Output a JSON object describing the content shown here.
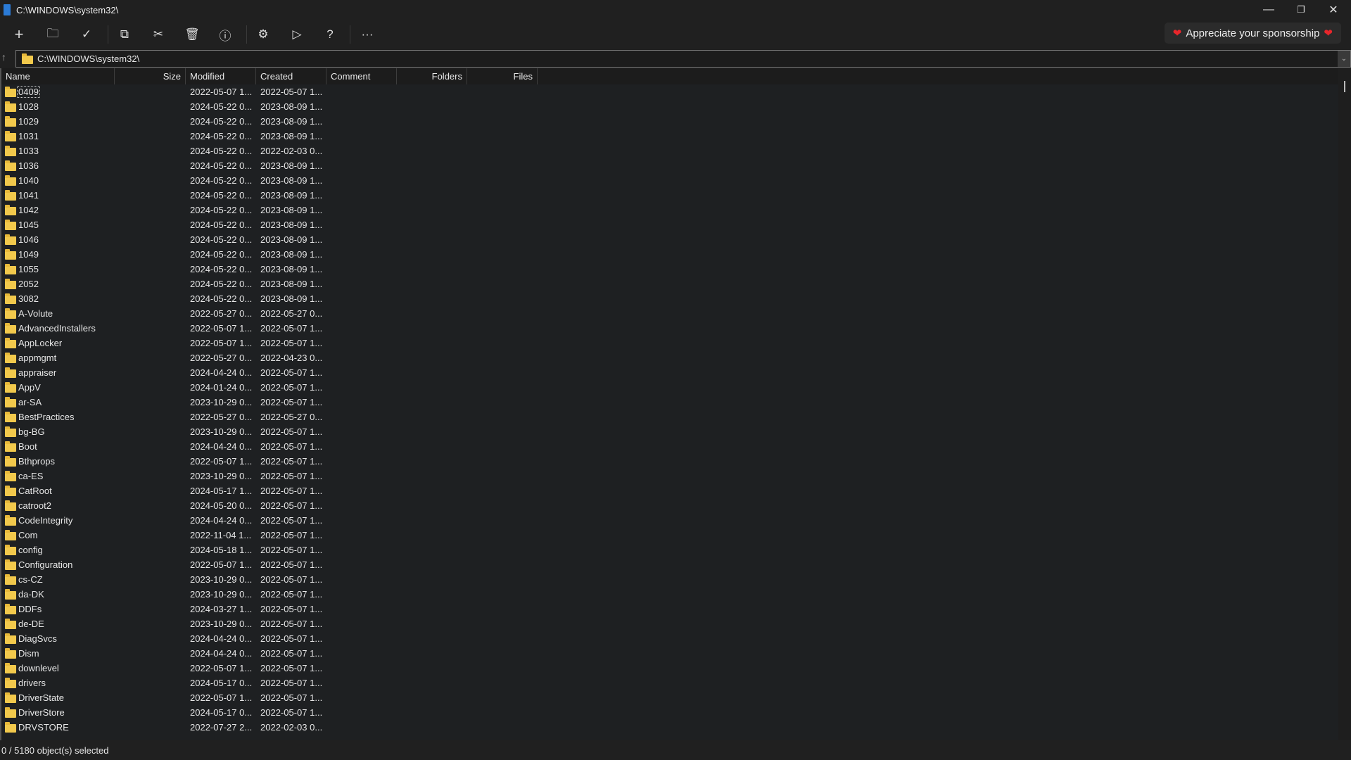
{
  "window": {
    "title": "C:\\WINDOWS\\system32\\"
  },
  "toolbar": {
    "buttons": [
      "add-icon",
      "extract-folder-icon",
      "test-icon",
      "copy-icon",
      "move-icon",
      "delete-icon",
      "info-icon",
      "settings-icon",
      "run-icon",
      "help-icon",
      "more-icon"
    ],
    "sponsor": "Appreciate your sponsorship"
  },
  "address": {
    "path": "C:\\WINDOWS\\system32\\"
  },
  "columns": [
    "Name",
    "Size",
    "Modified",
    "Created",
    "Comment",
    "Folders",
    "Files"
  ],
  "rows": [
    [
      "0409",
      "2022-05-07 1...",
      "2022-05-07 1..."
    ],
    [
      "1028",
      "2024-05-22 0...",
      "2023-08-09 1..."
    ],
    [
      "1029",
      "2024-05-22 0...",
      "2023-08-09 1..."
    ],
    [
      "1031",
      "2024-05-22 0...",
      "2023-08-09 1..."
    ],
    [
      "1033",
      "2024-05-22 0...",
      "2022-02-03 0..."
    ],
    [
      "1036",
      "2024-05-22 0...",
      "2023-08-09 1..."
    ],
    [
      "1040",
      "2024-05-22 0...",
      "2023-08-09 1..."
    ],
    [
      "1041",
      "2024-05-22 0...",
      "2023-08-09 1..."
    ],
    [
      "1042",
      "2024-05-22 0...",
      "2023-08-09 1..."
    ],
    [
      "1045",
      "2024-05-22 0...",
      "2023-08-09 1..."
    ],
    [
      "1046",
      "2024-05-22 0...",
      "2023-08-09 1..."
    ],
    [
      "1049",
      "2024-05-22 0...",
      "2023-08-09 1..."
    ],
    [
      "1055",
      "2024-05-22 0...",
      "2023-08-09 1..."
    ],
    [
      "2052",
      "2024-05-22 0...",
      "2023-08-09 1..."
    ],
    [
      "3082",
      "2024-05-22 0...",
      "2023-08-09 1..."
    ],
    [
      "A-Volute",
      "2022-05-27 0...",
      "2022-05-27 0..."
    ],
    [
      "AdvancedInstallers",
      "2022-05-07 1...",
      "2022-05-07 1..."
    ],
    [
      "AppLocker",
      "2022-05-07 1...",
      "2022-05-07 1..."
    ],
    [
      "appmgmt",
      "2022-05-27 0...",
      "2022-04-23 0..."
    ],
    [
      "appraiser",
      "2024-04-24 0...",
      "2022-05-07 1..."
    ],
    [
      "AppV",
      "2024-01-24 0...",
      "2022-05-07 1..."
    ],
    [
      "ar-SA",
      "2023-10-29 0...",
      "2022-05-07 1..."
    ],
    [
      "BestPractices",
      "2022-05-27 0...",
      "2022-05-27 0..."
    ],
    [
      "bg-BG",
      "2023-10-29 0...",
      "2022-05-07 1..."
    ],
    [
      "Boot",
      "2024-04-24 0...",
      "2022-05-07 1..."
    ],
    [
      "Bthprops",
      "2022-05-07 1...",
      "2022-05-07 1..."
    ],
    [
      "ca-ES",
      "2023-10-29 0...",
      "2022-05-07 1..."
    ],
    [
      "CatRoot",
      "2024-05-17 1...",
      "2022-05-07 1..."
    ],
    [
      "catroot2",
      "2024-05-20 0...",
      "2022-05-07 1..."
    ],
    [
      "CodeIntegrity",
      "2024-04-24 0...",
      "2022-05-07 1..."
    ],
    [
      "Com",
      "2022-11-04 1...",
      "2022-05-07 1..."
    ],
    [
      "config",
      "2024-05-18 1...",
      "2022-05-07 1..."
    ],
    [
      "Configuration",
      "2022-05-07 1...",
      "2022-05-07 1..."
    ],
    [
      "cs-CZ",
      "2023-10-29 0...",
      "2022-05-07 1..."
    ],
    [
      "da-DK",
      "2023-10-29 0...",
      "2022-05-07 1..."
    ],
    [
      "DDFs",
      "2024-03-27 1...",
      "2022-05-07 1..."
    ],
    [
      "de-DE",
      "2023-10-29 0...",
      "2022-05-07 1..."
    ],
    [
      "DiagSvcs",
      "2024-04-24 0...",
      "2022-05-07 1..."
    ],
    [
      "Dism",
      "2024-04-24 0...",
      "2022-05-07 1..."
    ],
    [
      "downlevel",
      "2022-05-07 1...",
      "2022-05-07 1..."
    ],
    [
      "drivers",
      "2024-05-17 0...",
      "2022-05-07 1..."
    ],
    [
      "DriverState",
      "2022-05-07 1...",
      "2022-05-07 1..."
    ],
    [
      "DriverStore",
      "2024-05-17 0...",
      "2022-05-07 1..."
    ],
    [
      "DRVSTORE",
      "2022-07-27 2...",
      "2022-02-03 0..."
    ]
  ],
  "status": "0 / 5180 object(s) selected"
}
